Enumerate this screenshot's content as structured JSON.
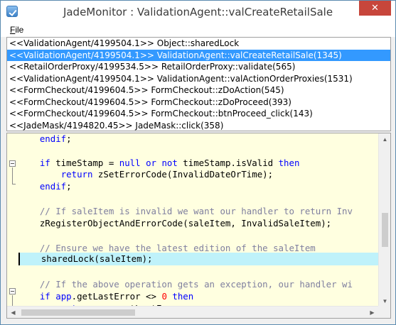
{
  "window": {
    "title": "JadeMonitor : ValidationAgent::valCreateRetailSale",
    "close_glyph": "✕",
    "accent_color": "#c7463b"
  },
  "menu": {
    "file_first": "F",
    "file_rest": "ile"
  },
  "call_stack": {
    "selected_index": 1,
    "selection_color": "#3399ff",
    "rows": [
      "<<ValidationAgent/4199504.1>> Object::sharedLock",
      "<<ValidationAgent/4199504.1>> ValidationAgent::valCreateRetailSale(1345)",
      "<<RetailOrderProxy/4199534.5>> RetailOrderProxy::validate(565)",
      "<<ValidationAgent/4199504.1>> ValidationAgent::valActionOrderProxies(1531)",
      "<<FormCheckout/4199604.5>> FormCheckout::zDoAction(545)",
      "<<FormCheckout/4199604.5>> FormCheckout::zDoProceed(393)",
      "<<FormCheckout/4199604.5>> FormCheckout::btnProceed_click(143)",
      "<<JadeMask/4194820.45>> JadeMask::click(358)"
    ]
  },
  "code": {
    "highlight_color": "#bff2fa",
    "lines": [
      {
        "segments": [
          {
            "t": "    ",
            "c": "tx"
          },
          {
            "t": "endif",
            "c": "kw"
          },
          {
            "t": ";",
            "c": "tx"
          }
        ]
      },
      {
        "segments": []
      },
      {
        "segments": [
          {
            "t": "    ",
            "c": "tx"
          },
          {
            "t": "if",
            "c": "kw"
          },
          {
            "t": " timeStamp = ",
            "c": "tx"
          },
          {
            "t": "null",
            "c": "kw"
          },
          {
            "t": " ",
            "c": "tx"
          },
          {
            "t": "or",
            "c": "kw"
          },
          {
            "t": " ",
            "c": "tx"
          },
          {
            "t": "not",
            "c": "kw"
          },
          {
            "t": " timeStamp.isValid ",
            "c": "tx"
          },
          {
            "t": "then",
            "c": "kw"
          }
        ]
      },
      {
        "segments": [
          {
            "t": "        ",
            "c": "tx"
          },
          {
            "t": "return",
            "c": "kw"
          },
          {
            "t": " zSetErrorCode(InvalidDateOrTime);",
            "c": "tx"
          }
        ]
      },
      {
        "segments": [
          {
            "t": "    ",
            "c": "tx"
          },
          {
            "t": "endif",
            "c": "kw"
          },
          {
            "t": ";",
            "c": "tx"
          }
        ]
      },
      {
        "segments": []
      },
      {
        "segments": [
          {
            "t": "    // If saleItem is invalid we want our handler to return Inv",
            "c": "cm"
          }
        ]
      },
      {
        "segments": [
          {
            "t": "    zRegisterObjectAndErrorCode(saleItem, InvalidSaleItem);",
            "c": "tx"
          }
        ]
      },
      {
        "segments": []
      },
      {
        "segments": [
          {
            "t": "    // Ensure we have the latest edition of the saleItem",
            "c": "cm"
          }
        ]
      },
      {
        "segments": [
          {
            "t": "    sharedLock(saleItem);",
            "c": "tx"
          }
        ],
        "highlight": true
      },
      {
        "segments": []
      },
      {
        "segments": [
          {
            "t": "    // If the above operation gets an exception, our handler wi",
            "c": "cm"
          }
        ]
      },
      {
        "segments": [
          {
            "t": "    ",
            "c": "tx"
          },
          {
            "t": "if",
            "c": "kw"
          },
          {
            "t": " ",
            "c": "tx"
          },
          {
            "t": "app",
            "c": "kw"
          },
          {
            "t": ".getLastError <> ",
            "c": "tx"
          },
          {
            "t": "0",
            "c": "num"
          },
          {
            "t": " ",
            "c": "tx"
          },
          {
            "t": "then",
            "c": "kw"
          }
        ]
      },
      {
        "segments": [
          {
            "t": "        ",
            "c": "tx"
          },
          {
            "t": "return",
            "c": "kw"
          },
          {
            "t": " ",
            "c": "tx"
          },
          {
            "t": "app",
            "c": "kw"
          },
          {
            "t": ".getLastError;",
            "c": "tx"
          }
        ]
      }
    ]
  }
}
